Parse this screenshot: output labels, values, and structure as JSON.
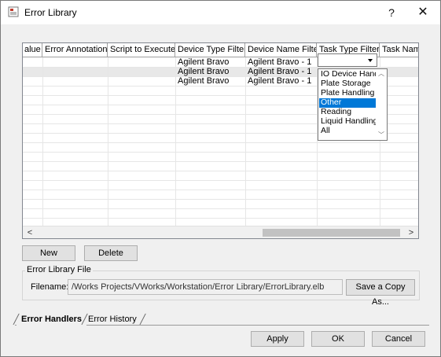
{
  "window": {
    "title": "Error Library",
    "help_glyph": "?",
    "close_glyph": "✕"
  },
  "grid": {
    "columns": [
      "alue",
      "Error Annotation",
      "Script to Execute",
      "Device Type Filter",
      "Device Name Filter",
      "Task Type Filter",
      "Task Name"
    ],
    "rows": [
      {
        "device_type": "Agilent Bravo",
        "device_name": "Agilent Bravo - 1"
      },
      {
        "device_type": "Agilent Bravo",
        "device_name": "Agilent Bravo - 1"
      },
      {
        "device_type": "Agilent Bravo",
        "device_name": "Agilent Bravo - 1"
      }
    ],
    "task_type_dropdown": {
      "value": "",
      "options": [
        "IO Device Hand",
        "Plate Storage",
        "Plate Handling",
        "Other",
        "Reading",
        "Liquid Handling",
        "All"
      ],
      "selected_option": "Other"
    }
  },
  "buttons": {
    "new": "New",
    "delete": "Delete",
    "save_copy": "Save a Copy As...",
    "apply": "Apply",
    "ok": "OK",
    "cancel": "Cancel"
  },
  "library_file": {
    "group_label": "Error Library File",
    "filename_label": "Filename:",
    "filename_value": "/Works Projects/VWorks/Workstation/Error Library/ErrorLibrary.elb"
  },
  "tabs": [
    {
      "label": "Error Handlers",
      "active": true
    },
    {
      "label": "Error History",
      "active": false
    }
  ],
  "colors": {
    "selection": "#0078d7",
    "dialog_bg": "#f0f0f0"
  }
}
